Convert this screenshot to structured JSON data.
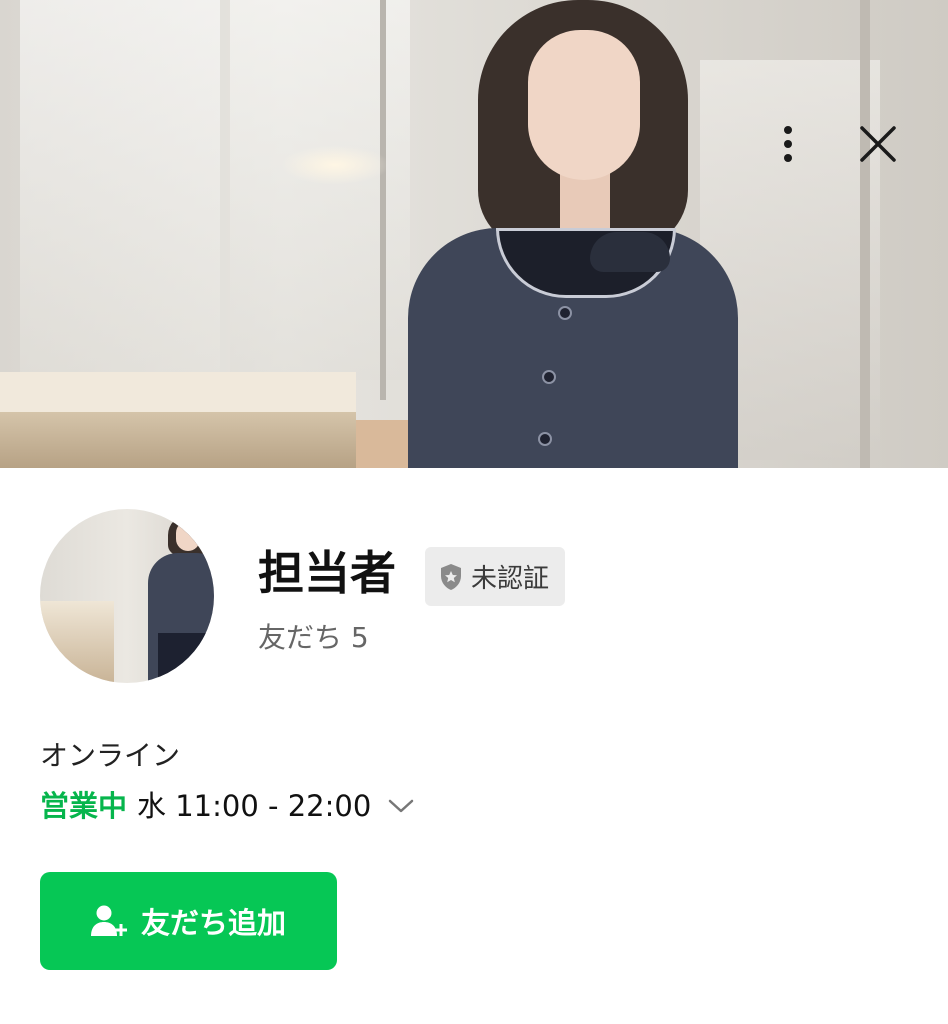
{
  "profile": {
    "name": "担当者",
    "badge_label": "未認証",
    "friends_label": "友だち 5"
  },
  "status": {
    "online_text": "オンライン",
    "open_label": "営業中",
    "hours_text": "水 11:00 - 22:00"
  },
  "actions": {
    "add_friend_label": "友だち追加"
  },
  "icons": {
    "menu": "more-vertical-icon",
    "close": "close-icon",
    "badge": "shield-star-icon",
    "expand": "chevron-down-icon",
    "add_friend": "add-person-icon"
  },
  "colors": {
    "accent_green": "#06c755",
    "open_status_green": "#06b54c",
    "badge_bg": "#ececec"
  }
}
